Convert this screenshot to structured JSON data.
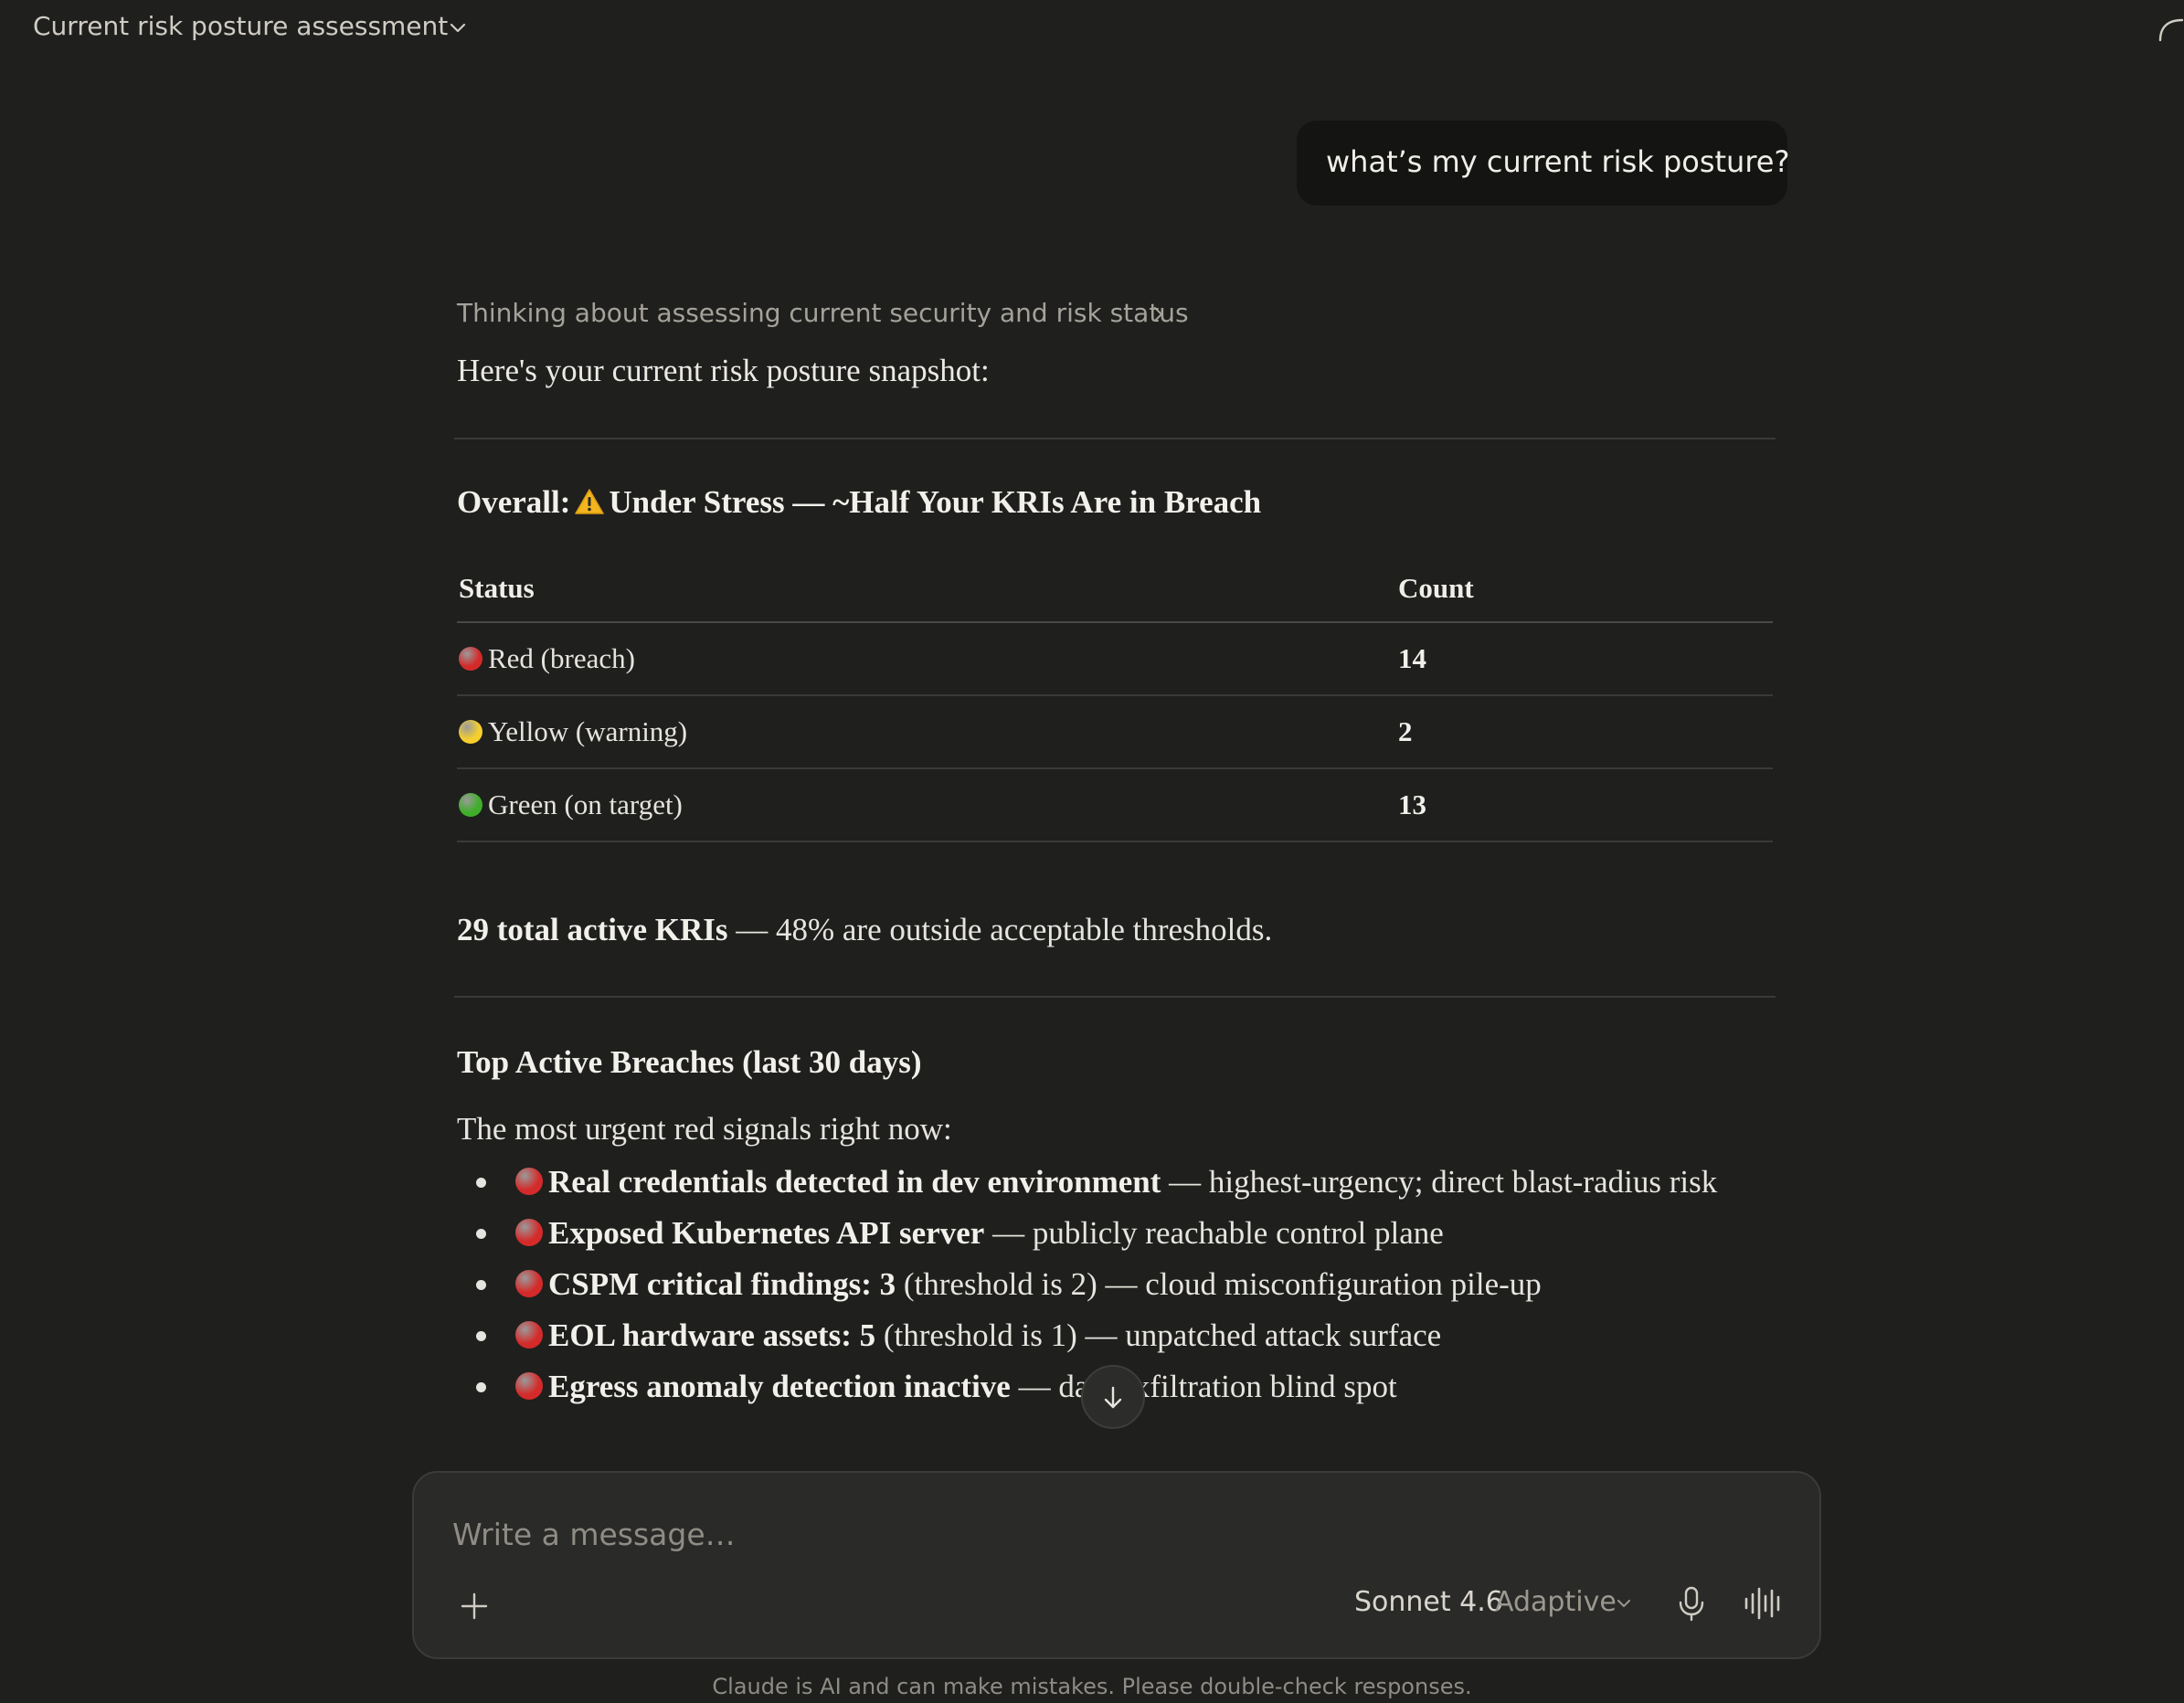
{
  "header": {
    "conversation_title": "Current risk posture assessment"
  },
  "user_message": "what’s my current risk posture?",
  "assistant": {
    "thinking_label": "Thinking about assessing current security and risk status",
    "intro": "Here's your current risk posture snapshot:",
    "overall": {
      "prefix": "Overall:",
      "text": "Under Stress — ~Half Your KRIs Are in Breach"
    },
    "table": {
      "headers": {
        "status": "Status",
        "count": "Count"
      },
      "rows": [
        {
          "label": "Red (breach)",
          "count": "14",
          "color": "#d42a2a"
        },
        {
          "label": "Yellow (warning)",
          "count": "2",
          "color": "#f5cf2e"
        },
        {
          "label": "Green (on target)",
          "count": "13",
          "color": "#3fae2a"
        }
      ]
    },
    "summary": {
      "bold": "29 total active KRIs",
      "rest": " — 48% are outside acceptable thresholds."
    },
    "breaches_heading": "Top Active Breaches (last 30 days)",
    "breaches_intro": "The most urgent red signals right now:",
    "breaches": [
      {
        "bold": "Real credentials detected in dev environment",
        "rest": " — highest-urgency; direct blast-radius risk"
      },
      {
        "bold": "Exposed Kubernetes API server",
        "rest": " — publicly reachable control plane"
      },
      {
        "bold": "CSPM critical findings: 3",
        "rest": " (threshold is 2) — cloud misconfiguration pile-up"
      },
      {
        "bold": "EOL hardware assets: 5",
        "rest": " (threshold is 1) — unpatched attack surface"
      },
      {
        "bold": "Egress anomaly detection inactive",
        "rest": " — data exfiltration blind spot"
      }
    ]
  },
  "composer": {
    "placeholder": "Write a message…",
    "model": "Sonnet 4.6",
    "mode": "Adaptive"
  },
  "footer": {
    "disclaimer": "Claude is AI and can make mistakes. Please double-check responses."
  },
  "colors": {
    "background": "#1f1f1e",
    "breach_red": "#d42a2a",
    "warning_yellow": "#f5cf2e",
    "target_green": "#3fae2a"
  }
}
